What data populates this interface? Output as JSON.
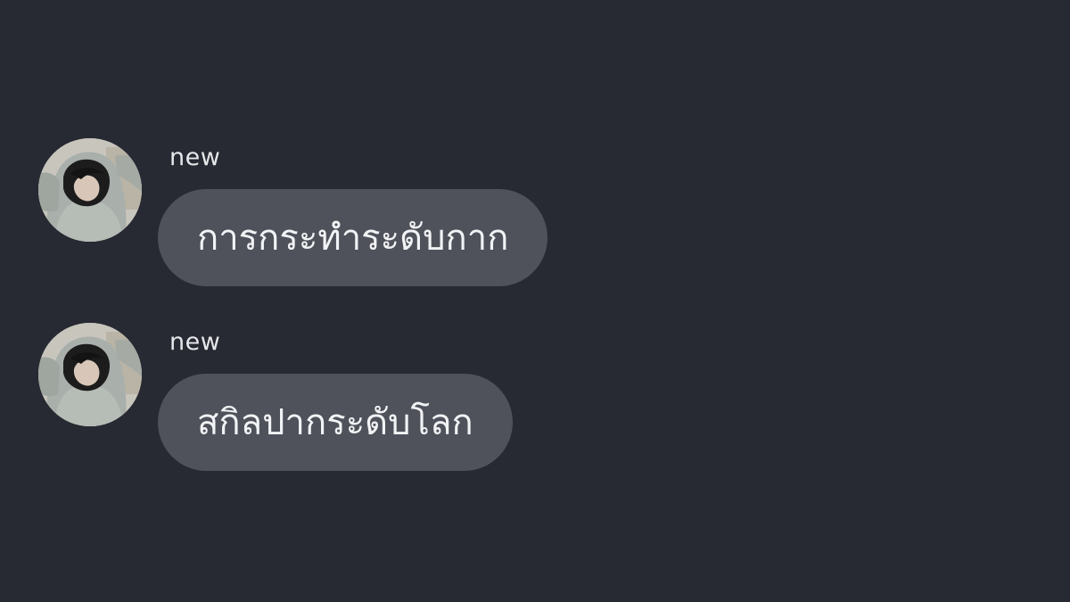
{
  "colors": {
    "background": "#272a32",
    "bubble": "#4f525b",
    "text": "#f2f3f5",
    "name": "#e6e7ea"
  },
  "messages": [
    {
      "sender": "new",
      "text": "การกระทำระดับกาก",
      "avatar": "hooded-person-avatar"
    },
    {
      "sender": "new",
      "text": "สกิลปากระดับโลก",
      "avatar": "hooded-person-avatar"
    }
  ]
}
